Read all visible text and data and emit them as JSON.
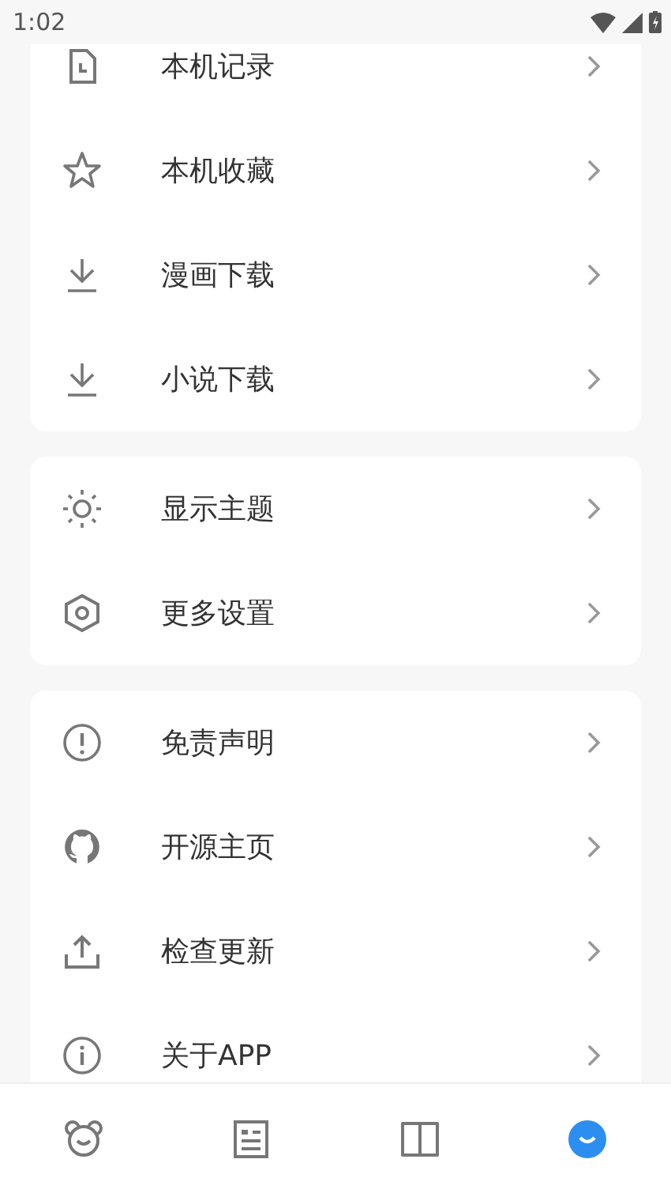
{
  "status_bar": {
    "time": "1:02"
  },
  "groups": [
    {
      "items": [
        {
          "kind": "history",
          "label": "本机记录"
        },
        {
          "kind": "star",
          "label": "本机收藏"
        },
        {
          "kind": "download",
          "label": "漫画下载"
        },
        {
          "kind": "download",
          "label": "小说下载"
        }
      ]
    },
    {
      "items": [
        {
          "kind": "sun",
          "label": "显示主题"
        },
        {
          "kind": "hexagon",
          "label": "更多设置"
        }
      ]
    },
    {
      "items": [
        {
          "kind": "alert",
          "label": "免责声明"
        },
        {
          "kind": "github",
          "label": "开源主页"
        },
        {
          "kind": "upload",
          "label": "检查更新"
        },
        {
          "kind": "info",
          "label": "关于APP"
        }
      ]
    }
  ],
  "bottom_nav": [
    {
      "kind": "bear",
      "selected": false
    },
    {
      "kind": "article",
      "selected": false
    },
    {
      "kind": "book",
      "selected": false
    },
    {
      "kind": "smile",
      "selected": true
    }
  ]
}
